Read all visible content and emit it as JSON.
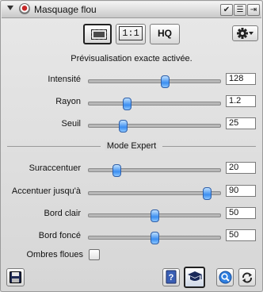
{
  "window": {
    "title": "Masquage flou",
    "buttons": [
      "✔",
      "☰",
      "⇥"
    ]
  },
  "toolbar": {
    "viewport_icon": "viewport-preview-icon",
    "one_to_one_label": "1:1",
    "hq_label": "HQ",
    "settings_icon": "gear-icon"
  },
  "status": "Prévisualisation exacte activée.",
  "sliders": [
    {
      "label": "Intensité",
      "value": "128",
      "fraction": 0.58
    },
    {
      "label": "Rayon",
      "value": "1.2",
      "fraction": 0.29
    },
    {
      "label": "Seuil",
      "value": "25",
      "fraction": 0.26
    }
  ],
  "expert": {
    "section_title": "Mode Expert",
    "sliders": [
      {
        "label": "Suraccentuer",
        "value": "20",
        "fraction": 0.21
      },
      {
        "label": "Accentuer jusqu'à",
        "value": "90",
        "fraction": 0.9
      },
      {
        "label": "Bord clair",
        "value": "50",
        "fraction": 0.5
      },
      {
        "label": "Bord foncé",
        "value": "50",
        "fraction": 0.5
      }
    ]
  },
  "checkbox": {
    "label": "Ombres floues",
    "checked": false
  },
  "bottom_icons": {
    "save": "save-icon",
    "help": "help-icon",
    "learn": "graduation-cap-icon",
    "zoom": "zoom-icon",
    "reset": "reset-icon"
  },
  "colors": {
    "accent": "#3b8ef0",
    "panel": "#dcdcdc"
  }
}
